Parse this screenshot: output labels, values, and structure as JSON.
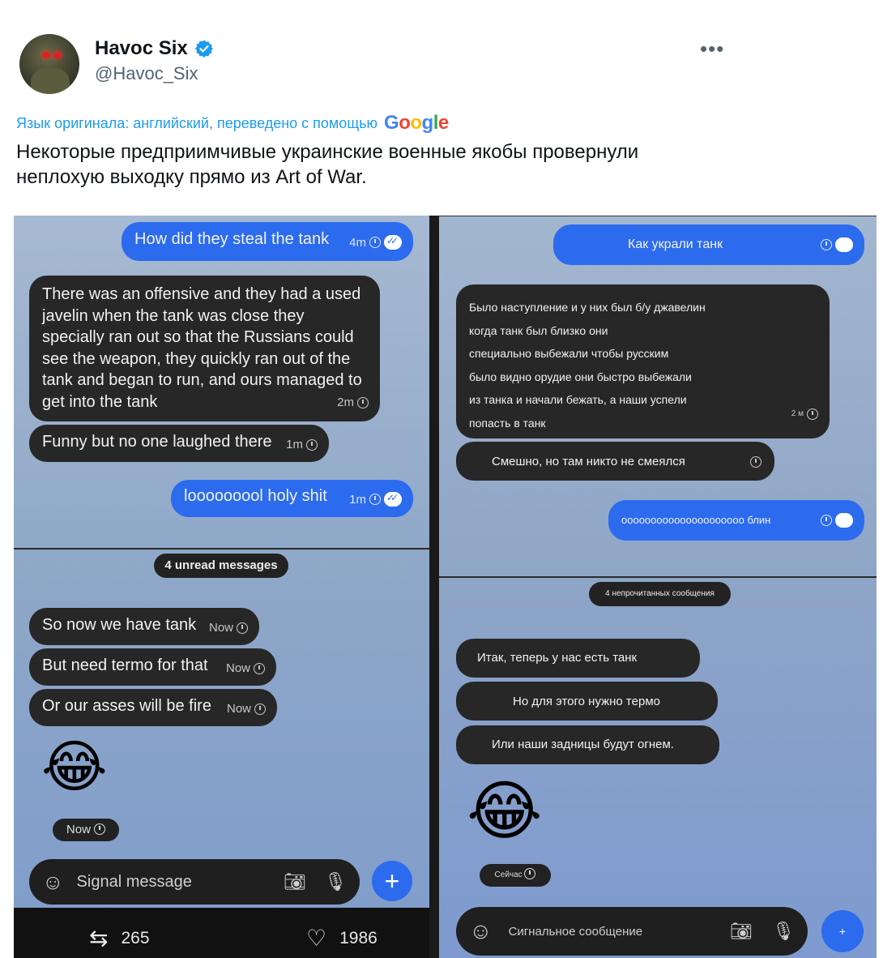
{
  "author": {
    "name": "Havoc Six",
    "handle": "@Havoc_Six",
    "more_label": "•••"
  },
  "translation": {
    "label": "Язык оригинала: английский, переведено с помощью",
    "brand": [
      "G",
      "o",
      "o",
      "g",
      "l",
      "e"
    ]
  },
  "tweet": {
    "text": "Некоторые предприимчивые украинские военные якобы провернули неплохую выходку прямо из Art of War."
  },
  "left_chat": {
    "msg1": {
      "text": "How did they steal the tank",
      "time": "4m"
    },
    "msg2": {
      "text": "There was an offensive and they had a used javelin when the tank was close they specially ran out so that the Russians could see the weapon, they quickly ran out of the tank and began to run, and ours managed to get into the tank",
      "time": "2m"
    },
    "msg3": {
      "text": "Funny but no one laughed there",
      "time": "1m"
    },
    "msg4": {
      "text": "looooooool holy shit",
      "time": "1m"
    },
    "unread": "4 unread messages",
    "msg5": {
      "text": "So now we have tank",
      "time": "Now"
    },
    "msg6": {
      "text": "But need termo for that",
      "time": "Now"
    },
    "msg7": {
      "text": "Or our asses will be fire",
      "time": "Now"
    },
    "emoji": "😂",
    "emoji_time": "Now",
    "composer_placeholder": "Signal message",
    "plus": "+"
  },
  "right_chat": {
    "msg1": {
      "text": "Как украли танк"
    },
    "msg2": {
      "lines": [
        "Было наступление и у них был б/у джавелин",
        "когда танк был близко они",
        "специально выбежали чтобы русским",
        "было видно орудие они быстро выбежали",
        "из танка и начали бежать, а наши успели",
        "попасть в танк"
      ],
      "time": "2 м"
    },
    "msg3": {
      "text": "Смешно, но там никто не смеялся"
    },
    "msg4": {
      "text": "ооооооооооооооооооооо блин"
    },
    "unread": "4 непрочитанных сообщения",
    "msg5": {
      "text": "Итак, теперь у нас есть танк"
    },
    "msg6": {
      "text": "Но для этого нужно термо"
    },
    "msg7": {
      "text": "Или наши задницы будут огнем."
    },
    "emoji": "😂",
    "emoji_time": "Сейчас",
    "composer_placeholder": "Сигнальное сообщение",
    "plus": "+"
  },
  "stats": {
    "retweets": "265",
    "likes": "1986"
  }
}
